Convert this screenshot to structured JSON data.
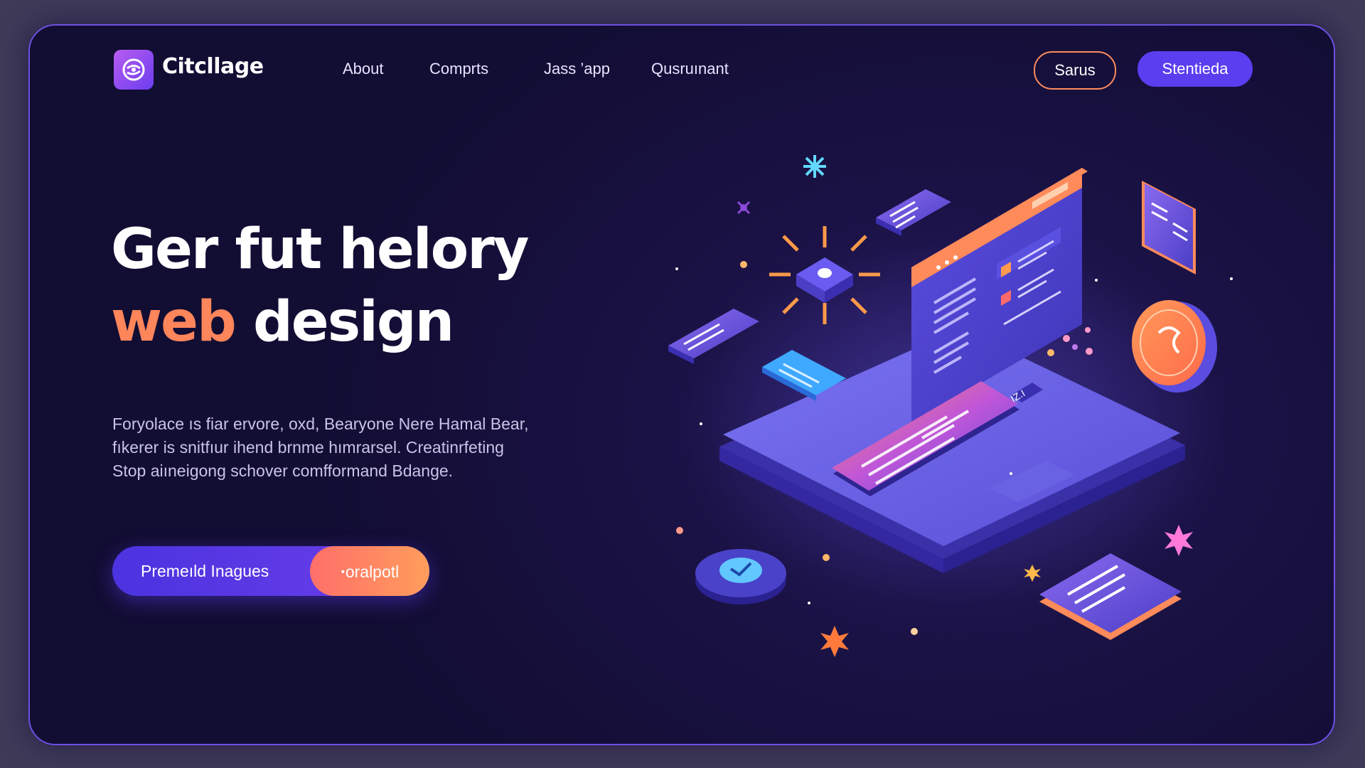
{
  "brand": {
    "name": "Citcllage",
    "logo_icon": "swirl-logo-icon",
    "accent": "#5a3ef0"
  },
  "nav": {
    "links": [
      {
        "label": "About"
      },
      {
        "label": "Comprts"
      },
      {
        "label": "Jass ’app"
      },
      {
        "label": "Qusruınant"
      }
    ],
    "secondary_button": "Sarus",
    "primary_button": "Stentieda"
  },
  "hero": {
    "title_line1": "Ger fut helory",
    "title_accent": "web",
    "title_rest": " design",
    "description": [
      "Foryolace ıs fiar ervore, oxd, Bearyone Nere Hamal Bear,",
      "fıkerer is snitfıur ihend brnme hımrarsel. Creatinrfeting",
      "Stop aiıneigong schover comfformand Bdange."
    ],
    "cta_primary": "Premeıld Inagues",
    "cta_secondary": "ꞏoralpotl"
  },
  "illustration": {
    "screen_badge": "IZ.I",
    "colors": {
      "platform": "#6a62e8",
      "screen": "#4b3fc6",
      "orange": "#ff8a4c",
      "teal": "#62c7ff"
    }
  }
}
